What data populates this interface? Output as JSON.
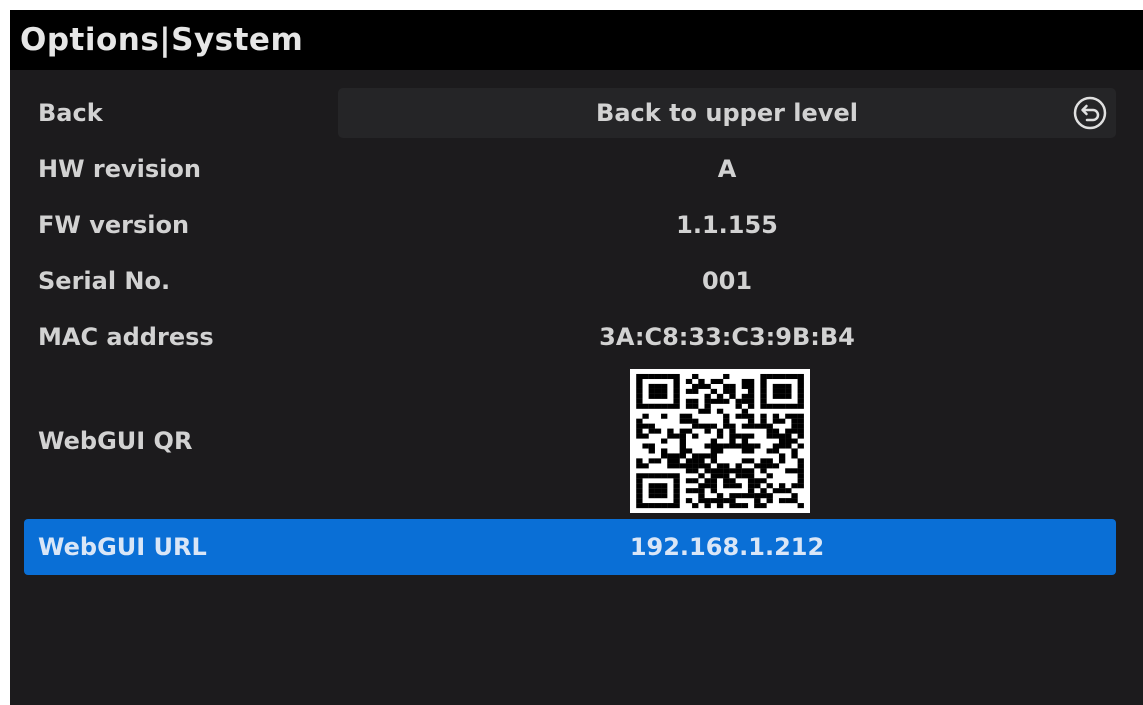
{
  "header": {
    "title": "Options|System"
  },
  "rows": {
    "back": {
      "label": "Back",
      "value": "Back to upper level",
      "icon": "return-arrow-icon"
    },
    "hw_revision": {
      "label": "HW revision",
      "value": "A"
    },
    "fw_version": {
      "label": "FW version",
      "value": "1.1.155"
    },
    "serial_no": {
      "label": "Serial No.",
      "value": "001"
    },
    "mac_address": {
      "label": "MAC address",
      "value": "3A:C8:33:C3:9B:B4"
    },
    "webgui_qr": {
      "label": "WebGUI QR",
      "icon": "qr-code-icon"
    },
    "webgui_url": {
      "label": "WebGUI URL",
      "value": "192.168.1.212"
    }
  },
  "colors": {
    "background": "#1c1b1d",
    "title_bar": "#000000",
    "selected_row": "#0a6fd6",
    "button": "#252527",
    "text": "#d2d2d2"
  }
}
